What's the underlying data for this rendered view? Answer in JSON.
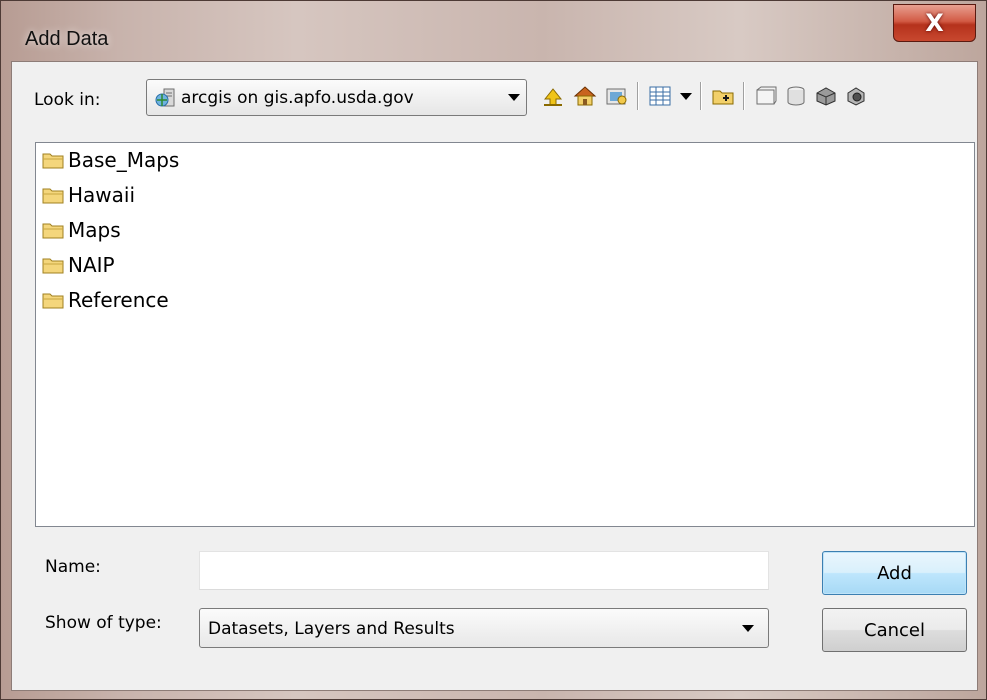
{
  "window": {
    "title": "Add Data",
    "close_glyph": "X"
  },
  "lookin": {
    "label": "Look in:",
    "value": "arcgis on gis.apfo.usda.gov",
    "icon": "server-connection-icon"
  },
  "toolbar": {
    "icons": [
      "up-one-level-icon",
      "home-icon",
      "connect-to-folder-icon",
      "views-icon",
      "new-folder-icon",
      "catalog-icon",
      "database-icon",
      "toolbox-icon",
      "tool-icon"
    ]
  },
  "list": {
    "items": [
      {
        "label": "Base_Maps",
        "icon": "folder-icon"
      },
      {
        "label": "Hawaii",
        "icon": "folder-icon"
      },
      {
        "label": "Maps",
        "icon": "folder-icon"
      },
      {
        "label": "NAIP",
        "icon": "folder-icon"
      },
      {
        "label": "Reference",
        "icon": "folder-icon"
      }
    ]
  },
  "name": {
    "label": "Name:",
    "value": ""
  },
  "type": {
    "label": "Show of type:",
    "value": "Datasets, Layers and Results"
  },
  "buttons": {
    "add": "Add",
    "cancel": "Cancel"
  }
}
